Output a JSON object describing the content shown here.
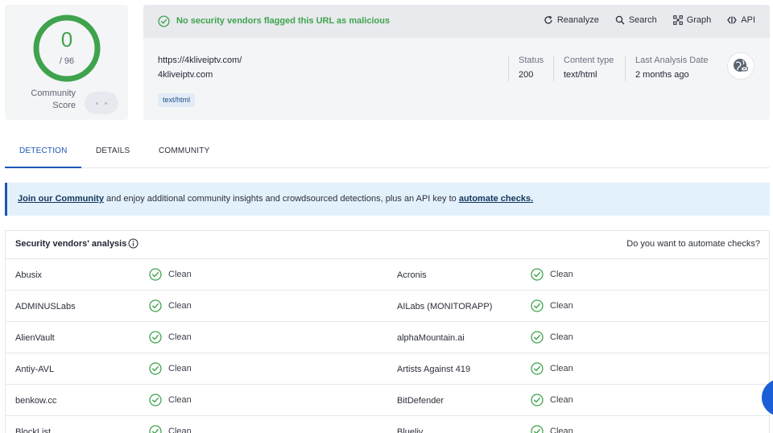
{
  "score": {
    "detections": "0",
    "total": "/ 96",
    "community_label": "Community Score"
  },
  "banner": {
    "message": "No security vendors flagged this URL as malicious"
  },
  "actions": [
    {
      "label": "Reanalyze",
      "icon": "refresh-icon"
    },
    {
      "label": "Search",
      "icon": "search-icon"
    },
    {
      "label": "Graph",
      "icon": "graph-icon"
    },
    {
      "label": "API",
      "icon": "api-icon"
    }
  ],
  "url": {
    "full": "https://4kliveiptv.com/",
    "host": "4kliveiptv.com",
    "tag": "text/html"
  },
  "meta": [
    {
      "key": "Status",
      "value": "200"
    },
    {
      "key": "Content type",
      "value": "text/html"
    },
    {
      "key": "Last Analysis Date",
      "value": "2 months ago"
    }
  ],
  "tabs": [
    {
      "label": "DETECTION",
      "active": true
    },
    {
      "label": "DETAILS",
      "active": false
    },
    {
      "label": "COMMUNITY",
      "active": false
    }
  ],
  "community_banner": {
    "link1": "Join our Community",
    "middle": " and enjoy additional community insights and crowdsourced detections, plus an API key to ",
    "link2": "automate checks."
  },
  "vendors": {
    "title": "Security vendors' analysis",
    "automate_prompt": "Do you want to automate checks?",
    "rows": [
      [
        {
          "name": "Abusix",
          "result": "Clean"
        },
        {
          "name": "Acronis",
          "result": "Clean"
        }
      ],
      [
        {
          "name": "ADMINUSLabs",
          "result": "Clean"
        },
        {
          "name": "AILabs (MONITORAPP)",
          "result": "Clean"
        }
      ],
      [
        {
          "name": "AlienVault",
          "result": "Clean"
        },
        {
          "name": "alphaMountain.ai",
          "result": "Clean"
        }
      ],
      [
        {
          "name": "Antiy-AVL",
          "result": "Clean"
        },
        {
          "name": "Artists Against 419",
          "result": "Clean"
        }
      ],
      [
        {
          "name": "benkow.cc",
          "result": "Clean"
        },
        {
          "name": "BitDefender",
          "result": "Clean"
        }
      ],
      [
        {
          "name": "BlockList",
          "result": "Clean"
        },
        {
          "name": "Blueliv",
          "result": "Clean"
        }
      ]
    ]
  },
  "colors": {
    "clean": "#3fa34d",
    "accent": "#1b57b5",
    "banner_bg": "#e3f1fc"
  }
}
